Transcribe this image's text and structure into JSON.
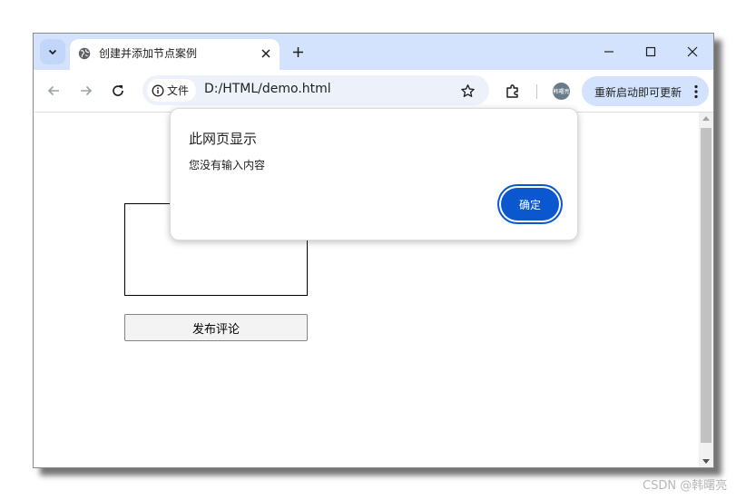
{
  "tab": {
    "title": "创建并添加节点案例"
  },
  "address": {
    "security_chip": "文件",
    "url": "D:/HTML/demo.html"
  },
  "toolbar": {
    "avatar_text": "韩曙亮",
    "update_label": "重新启动即可更新"
  },
  "page": {
    "publish_button": "发布评论"
  },
  "dialog": {
    "title": "此网页显示",
    "message": "您没有输入内容",
    "ok_label": "确定"
  },
  "watermark": "CSDN @韩曙亮",
  "colors": {
    "tabstrip": "#d3e3fd",
    "primary_button": "#0b57d0",
    "omnibox": "#edf2fa"
  },
  "icons": [
    "tab-search-icon",
    "globe-icon",
    "close-icon",
    "plus-icon",
    "minimize-icon",
    "maximize-icon",
    "back-icon",
    "forward-icon",
    "reload-icon",
    "info-icon",
    "star-icon",
    "extensions-icon",
    "more-icon"
  ]
}
